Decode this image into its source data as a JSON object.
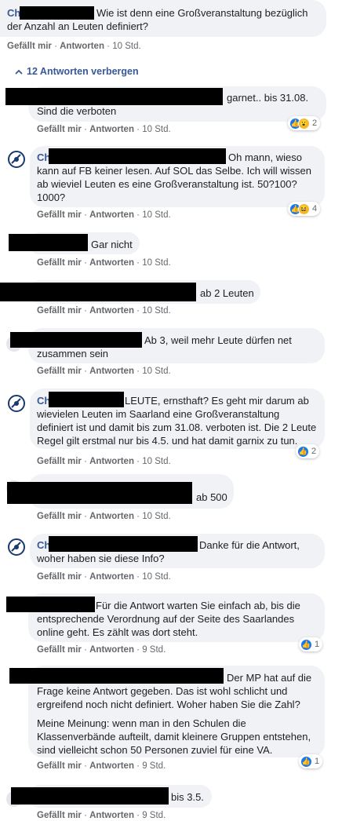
{
  "actions": {
    "like": "Gefällt mir",
    "reply": "Antworten"
  },
  "top": {
    "name_start": "Ch",
    "text_line1": "Wie ist denn eine Großveranstaltung bezüglich",
    "text_line2": "der Anzahl an Leuten definiert?",
    "time": "10 Std."
  },
  "toggle": {
    "label": "12 Antworten verbergen"
  },
  "replies": [
    {
      "line1": "garnet.. bis 31.08.",
      "line2": "Sind die verboten",
      "time": "10 Std.",
      "reactions": "2"
    },
    {
      "name_start": "Ch",
      "line1": "Oh mann, wieso",
      "line2": "kann auf FB keiner lesen. Auf SOL das Selbe. Ich will wissen",
      "line3": "ab wieviel Leuten es eine Großveranstaltung ist. 50?100?",
      "line4": "1000?",
      "time": "10 Std.",
      "reactions": "4"
    },
    {
      "line1": "Gar nicht",
      "time": "10 Std."
    },
    {
      "line1": "ab 2 Leuten",
      "time": "10 Std."
    },
    {
      "line1": "Ab 3, weil mehr Leute dürfen net",
      "line2": "zusammen sein",
      "time": "10 Std."
    },
    {
      "name_start": "Ch",
      "line1": "LEUTE, ernsthaft? Es geht mir darum ab",
      "line2": "wievielen Leuten im Saarland eine Großveranstaltung",
      "line3": "definiert ist und damit bis zum 31.08. verboten ist. Die 2 Leute",
      "line4": "Regel gilt erstmal nur bis 4.5. und hat damit garnix zu tun.",
      "time": "10 Std.",
      "reactions": "2"
    },
    {
      "line1": "ab 500",
      "time": "10 Std."
    },
    {
      "name_start": "Ch",
      "line1": "Danke für die Antwort,",
      "line2": "woher haben sie diese Info?",
      "time": "10 Std."
    },
    {
      "line1": "Für die Antwort warten Sie einfach ab, bis die",
      "line2": "entsprechende Verordnung auf der Seite des Saarlandes",
      "line3": "online geht. Es zählt was dort steht.",
      "time": "9 Std.",
      "reactions": "1"
    },
    {
      "line1": "Der MP hat auf die",
      "line2": "Frage keine Antwort gegeben. Das ist wohl schlicht und",
      "line3": "ergreifend noch nicht definiert. Woher haben Sie die Zahl?",
      "line4": "Meine Meinung: wenn man in den Schulen die",
      "line5": "Klassenverbände aufteilt, damit kleinere Gruppen entstehen,",
      "line6": "sind vielleicht schon 50 Personen zuviel für eine VA.",
      "time": "9 Std.",
      "reactions": "1"
    },
    {
      "line1": "bis 3.5.",
      "time": "9 Std."
    }
  ]
}
